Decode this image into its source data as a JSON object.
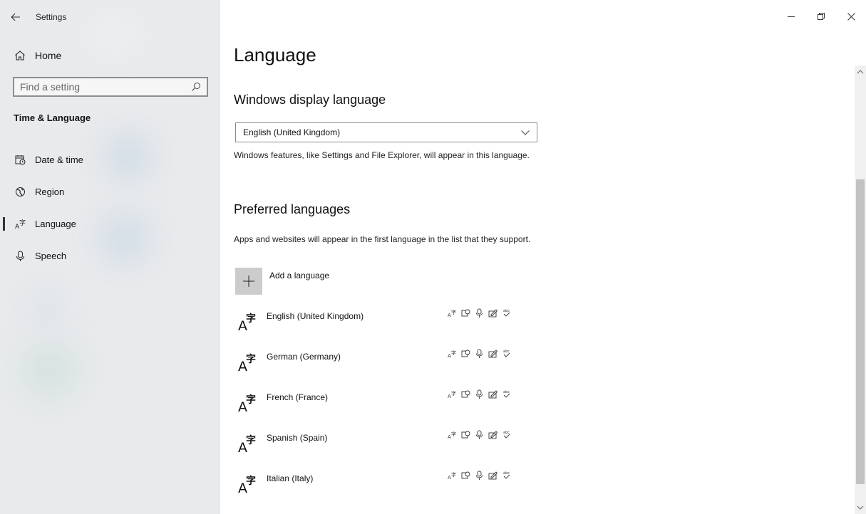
{
  "app": {
    "title": "Settings"
  },
  "sidebar": {
    "home_label": "Home",
    "search": {
      "placeholder": "Find a setting",
      "icon": "search-icon"
    },
    "section_title": "Time & Language",
    "items": [
      {
        "label": "Date & time",
        "icon": "calendar-clock-icon",
        "selected": false
      },
      {
        "label": "Region",
        "icon": "globe-icon",
        "selected": false
      },
      {
        "label": "Language",
        "icon": "language-icon",
        "selected": true
      },
      {
        "label": "Speech",
        "icon": "microphone-icon",
        "selected": false
      }
    ]
  },
  "main": {
    "page_title": "Language",
    "display_language": {
      "heading": "Windows display language",
      "selected": "English (United Kingdom)",
      "description": "Windows features, like Settings and File Explorer, will appear in this language."
    },
    "preferred": {
      "heading": "Preferred languages",
      "description": "Apps and websites will appear in the first language in the list that they support.",
      "add_label": "Add a language",
      "languages": [
        {
          "name": "English (United Kingdom)"
        },
        {
          "name": "German (Germany)"
        },
        {
          "name": "French (France)"
        },
        {
          "name": "Spanish (Spain)"
        },
        {
          "name": "Italian (Italy)"
        }
      ],
      "feature_icons": [
        "display-language-icon",
        "text-to-speech-icon",
        "speech-recognition-icon",
        "handwriting-icon",
        "spell-check-icon"
      ]
    }
  },
  "colors": {
    "sidebar_bg": "#e8eaec",
    "accent": "#333333",
    "add_button_bg": "#cccccc"
  }
}
